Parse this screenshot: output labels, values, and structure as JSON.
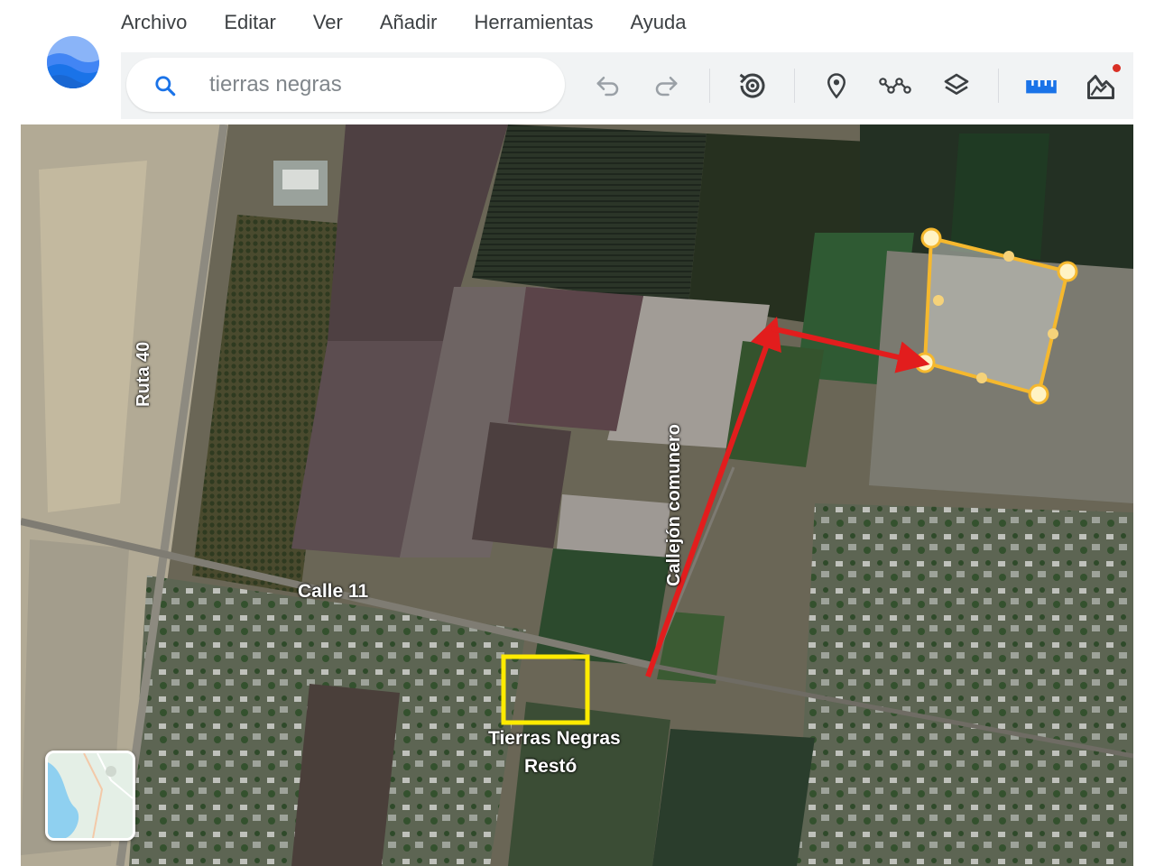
{
  "menu": {
    "items": [
      {
        "label": "Archivo"
      },
      {
        "label": "Editar"
      },
      {
        "label": "Ver"
      },
      {
        "label": "Añadir"
      },
      {
        "label": "Herramientas"
      },
      {
        "label": "Ayuda"
      }
    ]
  },
  "search": {
    "placeholder": "tierras negras",
    "value": ""
  },
  "toolbar": {
    "icons": [
      "undo-icon",
      "redo-icon",
      "historical-imagery-icon",
      "placemark-icon",
      "path-icon",
      "layers-icon",
      "ruler-icon",
      "elevation-profile-icon"
    ]
  },
  "map": {
    "labels": {
      "ruta40": "Ruta 40",
      "calle11": "Calle 11",
      "callejon": "Callejón comunero",
      "resto_line1": "Tierras Negras",
      "resto_line2": "Restó"
    }
  },
  "colors": {
    "accent": "#1a73e8",
    "arrow": "#e21d1d",
    "polygon": "#f5b82e",
    "highlight_box": "#ffeb00",
    "notification_dot": "#d93025"
  }
}
